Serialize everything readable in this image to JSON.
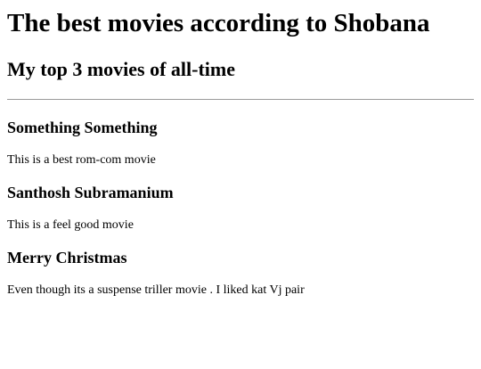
{
  "page": {
    "title": "The best movies according to Shobana",
    "subtitle": "My top 3 movies of all-time"
  },
  "movies": [
    {
      "name": "Something Something",
      "description": "This is a best rom-com movie"
    },
    {
      "name": "Santhosh Subramanium",
      "description": "This is a feel good movie"
    },
    {
      "name": "Merry Christmas",
      "description": "Even though its a suspense triller movie . I liked kat Vj pair"
    }
  ]
}
